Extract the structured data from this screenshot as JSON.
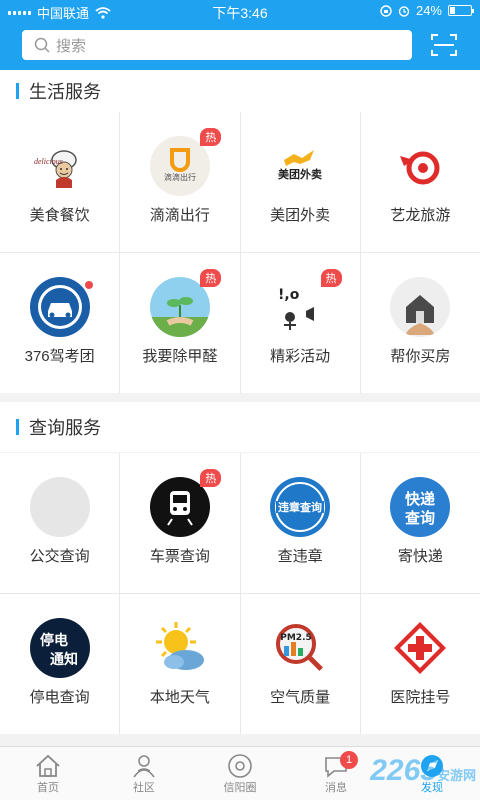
{
  "status_bar": {
    "carrier": "中国联通",
    "time": "下午3:46",
    "battery": "24%",
    "battery_level": 0.24
  },
  "search": {
    "placeholder": "搜索"
  },
  "sections": [
    {
      "title": "生活服务",
      "items": [
        {
          "label": "美食餐饮",
          "icon": "food-icon"
        },
        {
          "label": "滴滴出行",
          "icon": "didi-icon",
          "hot": "热"
        },
        {
          "label": "美团外卖",
          "icon": "meituan-icon"
        },
        {
          "label": "艺龙旅游",
          "icon": "elong-icon"
        },
        {
          "label": "376驾考团",
          "icon": "car-icon",
          "dot": true
        },
        {
          "label": "我要除甲醛",
          "icon": "plant-icon",
          "hot": "热"
        },
        {
          "label": "精彩活动",
          "icon": "activity-icon",
          "hot": "热"
        },
        {
          "label": "帮你买房",
          "icon": "house-icon"
        }
      ]
    },
    {
      "title": "查询服务",
      "items": [
        {
          "label": "公交查询",
          "icon": "bus-icon"
        },
        {
          "label": "车票查询",
          "icon": "train-icon",
          "hot": "热"
        },
        {
          "label": "查违章",
          "icon": "violation-icon"
        },
        {
          "label": "寄快递",
          "icon": "express-icon"
        },
        {
          "label": "停电查询",
          "icon": "power-icon"
        },
        {
          "label": "本地天气",
          "icon": "weather-icon"
        },
        {
          "label": "空气质量",
          "icon": "air-icon"
        },
        {
          "label": "医院挂号",
          "icon": "hospital-icon"
        }
      ]
    }
  ],
  "icon_text": {
    "didi": "滴滴出行",
    "meituan": "美团外卖",
    "violation": "违章查询",
    "express_line1": "快递",
    "express_line2": "查询",
    "power_line1": "停电",
    "power_line2": "通知",
    "air": "PM2.5"
  },
  "tabs": [
    {
      "label": "首页",
      "icon": "home-icon"
    },
    {
      "label": "社区",
      "icon": "community-icon"
    },
    {
      "label": "信阳圈",
      "icon": "circle-icon"
    },
    {
      "label": "消息",
      "icon": "message-icon",
      "badge": "1"
    },
    {
      "label": "发现",
      "icon": "discover-icon",
      "active": true
    }
  ],
  "watermark": {
    "number": "2265",
    "suffix": "安游网"
  },
  "colors": {
    "brand": "#1fa3f0",
    "hot": "#f04b4b"
  }
}
